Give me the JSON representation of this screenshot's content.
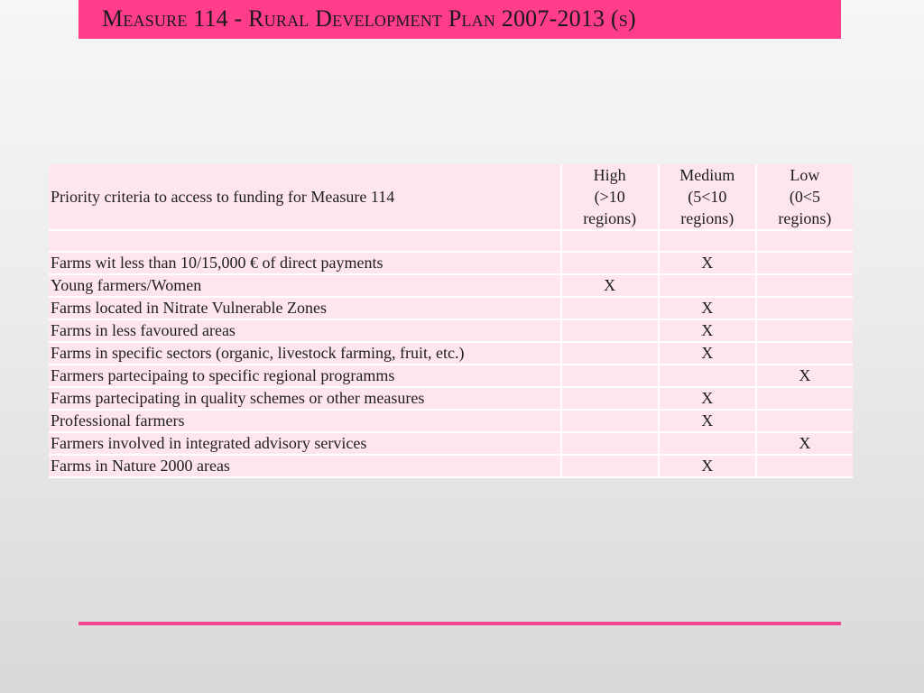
{
  "title": "Measure 114 - Rural Development Plan 2007-2013 (s)",
  "table": {
    "header": {
      "criteria": "Priority criteria to access to funding for Measure 114",
      "high": [
        "High",
        "(>10",
        "regions)"
      ],
      "medium": [
        "Medium",
        "(5<10",
        "regions)"
      ],
      "low": [
        "Low",
        "(0<5",
        "regions)"
      ]
    },
    "rows": [
      {
        "label": "Farms wit less than 10/15,000 € of direct payments",
        "high": "",
        "medium": "X",
        "low": ""
      },
      {
        "label": "Young farmers/Women",
        "high": "X",
        "medium": "",
        "low": ""
      },
      {
        "label": "Farms located in Nitrate Vulnerable Zones",
        "high": "",
        "medium": "X",
        "low": ""
      },
      {
        "label": "Farms in less favoured areas",
        "high": "",
        "medium": "X",
        "low": ""
      },
      {
        "label": "Farms in specific sectors (organic, livestock farming, fruit, etc.)",
        "high": "",
        "medium": "X",
        "low": ""
      },
      {
        "label": "Farmers partecipaing to specific regional programms",
        "high": "",
        "medium": "",
        "low": "X"
      },
      {
        "label": "Farms partecipating in quality schemes or other measures",
        "high": "",
        "medium": "X",
        "low": ""
      },
      {
        "label": "Professional farmers",
        "high": "",
        "medium": "X",
        "low": ""
      },
      {
        "label": "Farmers involved in integrated advisory services",
        "high": "",
        "medium": "",
        "low": "X"
      },
      {
        "label": "Farms in Nature 2000 areas",
        "high": "",
        "medium": "X",
        "low": ""
      }
    ]
  },
  "colors": {
    "title_bar": "#ff3d8a",
    "table_cell": "#ffe5ee",
    "bottom_rule": "#f0478f"
  }
}
